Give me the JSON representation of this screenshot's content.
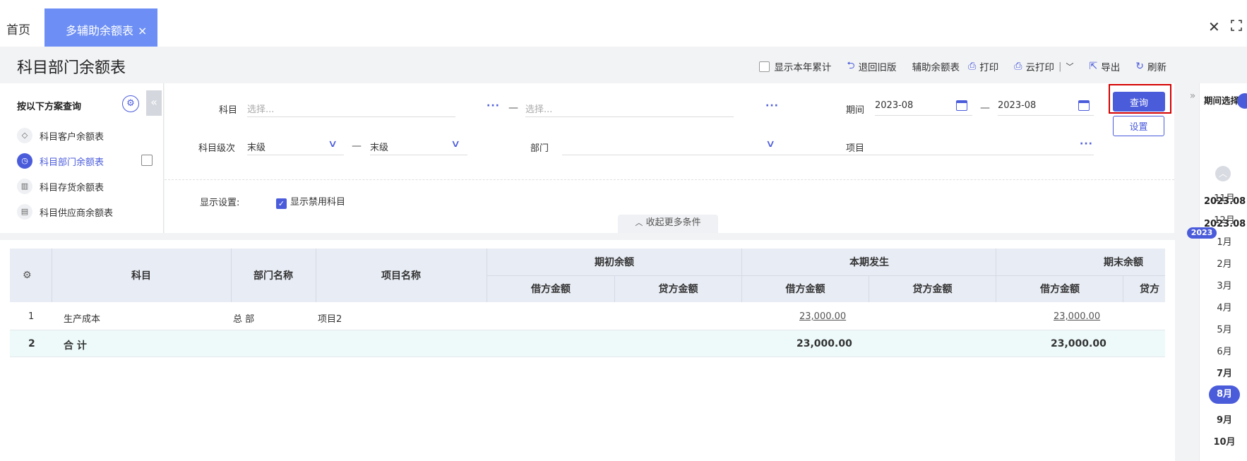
{
  "tabs": {
    "home": "首页",
    "active": "多辅助余额表",
    "active_close": "×"
  },
  "window": {
    "close": "✕"
  },
  "page_title": "科目部门余额表",
  "toolbar": {
    "show_year_total": "显示本年累计",
    "back_old": "退回旧版",
    "aux_balance": "辅助余额表",
    "print": "打印",
    "cloud_print": "云打印",
    "export": "导出",
    "refresh": "刷新"
  },
  "scheme": {
    "title": "按以下方案查询",
    "items": [
      {
        "label": "科目客户余额表"
      },
      {
        "label": "科目部门余额表"
      },
      {
        "label": "科目存货余额表"
      },
      {
        "label": "科目供应商余额表"
      }
    ]
  },
  "filters": {
    "subject_label": "科目",
    "subject_from_placeholder": "选择...",
    "subject_to_placeholder": "选择...",
    "period_label": "期间",
    "period_from": "2023-08",
    "period_to": "2023-08",
    "level_label": "科目级次",
    "level_from": "末级",
    "level_to": "末级",
    "dept_label": "部门",
    "dept_value": "",
    "project_label": "项目",
    "project_value": "",
    "display_label": "显示设置:",
    "show_disabled": "显示禁用科目",
    "collapse_more": "收起更多条件",
    "dash": "—"
  },
  "buttons": {
    "query": "查询",
    "settings": "设置"
  },
  "table": {
    "headers": {
      "subject": "科目",
      "dept": "部门名称",
      "project": "项目名称",
      "opening": "期初余额",
      "current": "本期发生",
      "closing": "期末余额",
      "debit": "借方金额",
      "credit": "贷方金额",
      "credit_cut": "贷方"
    },
    "rows": [
      {
        "no": "1",
        "subject": "生产成本",
        "dept": "总 部",
        "project": "项目2",
        "current_debit": "23,000.00",
        "closing_debit": "23,000.00"
      },
      {
        "no": "2",
        "subject": "合 计",
        "dept": "",
        "project": "",
        "current_debit": "23,000.00",
        "closing_debit": "23,000.00"
      }
    ]
  },
  "period_panel": {
    "title": "期间选择",
    "from": "2023.08",
    "to": "2023.08",
    "year": "2023",
    "months": [
      "11月",
      "12月",
      "1月",
      "2月",
      "3月",
      "4月",
      "5月",
      "6月",
      "7月",
      "8月",
      "9月",
      "10月"
    ],
    "selected": "8月"
  },
  "colors": {
    "accent": "#4b5cdb",
    "tab_active": "#6d8ff5",
    "highlight_border": "#d40000"
  }
}
